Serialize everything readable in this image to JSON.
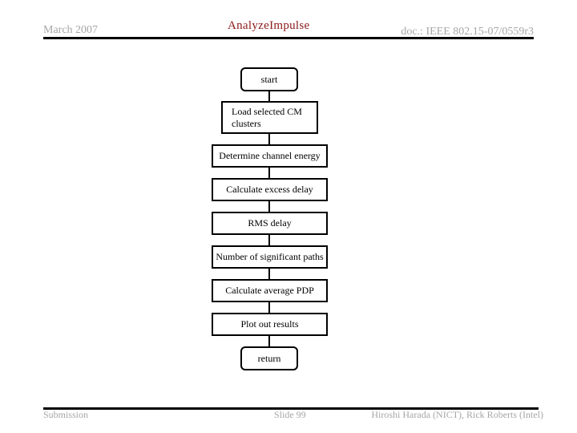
{
  "header": {
    "date": "March 2007",
    "title": "AnalyzeImpulse",
    "doc_id": "doc.: IEEE 802.15-07/0559r3"
  },
  "footer": {
    "left": "Submission",
    "center": "Slide 99",
    "right": "Hiroshi Harada (NICT), Rick Roberts (Intel)"
  },
  "flowchart": {
    "nodes": [
      {
        "id": "start",
        "type": "terminal",
        "label": "start"
      },
      {
        "id": "load",
        "type": "process",
        "label": "Load selected CM clusters"
      },
      {
        "id": "energy",
        "type": "process",
        "label": "Determine channel energy"
      },
      {
        "id": "excess",
        "type": "process",
        "label": "Calculate excess delay"
      },
      {
        "id": "rms",
        "type": "process",
        "label": "RMS delay"
      },
      {
        "id": "paths",
        "type": "process",
        "label": "Number of significant paths"
      },
      {
        "id": "pdp",
        "type": "process",
        "label": "Calculate average PDP"
      },
      {
        "id": "plot",
        "type": "process",
        "label": "Plot out results"
      },
      {
        "id": "return",
        "type": "terminal",
        "label": "return"
      }
    ],
    "edges": [
      [
        "start",
        "load"
      ],
      [
        "load",
        "energy"
      ],
      [
        "energy",
        "excess"
      ],
      [
        "excess",
        "rms"
      ],
      [
        "rms",
        "paths"
      ],
      [
        "paths",
        "pdp"
      ],
      [
        "pdp",
        "plot"
      ],
      [
        "plot",
        "return"
      ]
    ]
  },
  "colors": {
    "title": "#8b1a1a",
    "header_footer_text": "#a6a6a6",
    "rule": "#000000"
  }
}
